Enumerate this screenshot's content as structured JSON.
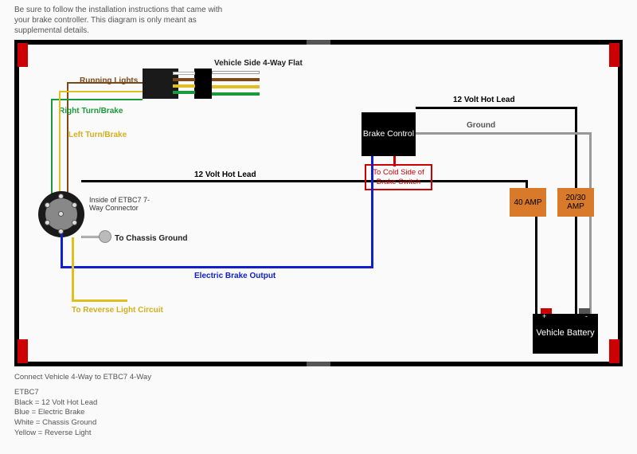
{
  "top_note": "Be sure to follow the installation instructions that came with your brake controller. This diagram is only meant as supplemental details.",
  "labels": {
    "vehicle_4way": "Vehicle Side 4-Way Flat",
    "running_lights": "Running Lights",
    "right_turn": "Right Turn/Brake",
    "left_turn": "Left Turn/Brake",
    "hot_lead_top": "12 Volt Hot Lead",
    "ground": "Ground",
    "hot_lead_mid": "12 Volt Hot Lead",
    "inside_connector": "Inside of ETBC7 7-Way Connector",
    "chassis_ground": "To Chassis Ground",
    "electric_brake": "Electric Brake Output",
    "reverse_light": "To Reverse Light Circuit"
  },
  "components": {
    "brake_control": "Brake Control",
    "cold_side": "To Cold Side of Brake Switch",
    "amp40": "40 AMP",
    "amp2030": "20/30 AMP",
    "battery": "Vehicle Battery"
  },
  "legend": {
    "title": "Connect Vehicle 4-Way to ETBC7 4-Way",
    "name": "ETBC7",
    "black": "Black = 12 Volt Hot Lead",
    "blue": "Blue = Electric Brake",
    "white": "White = Chassis Ground",
    "yellow": "Yellow = Reverse Light"
  },
  "colors": {
    "brown": "#7a4a1a",
    "green": "#1a9a3a",
    "yellow": "#e0c020",
    "black": "#000",
    "blue": "#1020d0",
    "red": "#c00",
    "white": "#fff",
    "gray": "#999"
  }
}
